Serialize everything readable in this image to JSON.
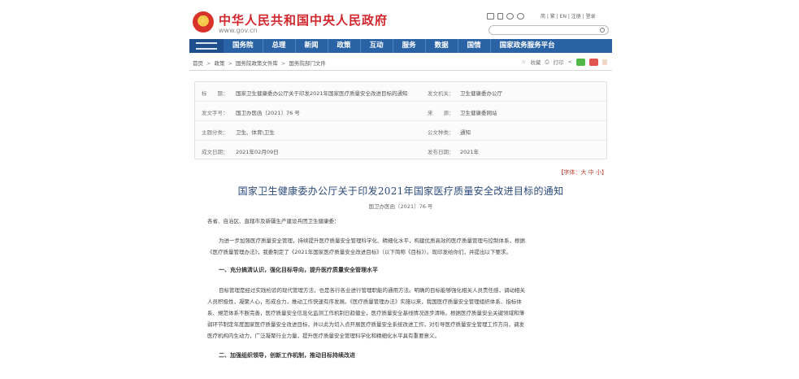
{
  "header": {
    "site_title": "中华人民共和国中央人民政府",
    "site_url": "www.gov.cn",
    "util_links": "简 | 繁 | EN | 注册 | 登录"
  },
  "nav": {
    "items": [
      "国务院",
      "总理",
      "新闻",
      "政策",
      "互动",
      "服务",
      "数据",
      "国情",
      "国家政务服务平台"
    ]
  },
  "breadcrumb": {
    "items": [
      "首页",
      "政策",
      "国务院政策文件库",
      "国务院部门文件"
    ]
  },
  "tools": {
    "favorite": "收藏",
    "print": "打印"
  },
  "doc_info": {
    "title_label": "标　　题：",
    "title_value": "国家卫生健康委办公厅关于印发2021年国家医疗质量安全改进目标的通知",
    "issuer_label": "发文机关：",
    "issuer_value": "卫生健康委办公厅",
    "number_label": "发文字号：",
    "number_value": "国卫办医函〔2021〕76 号",
    "source_label": "来　　源：",
    "source_value": "卫生健康委网站",
    "topic_label": "主题分类：",
    "topic_value": "卫生、体育\\卫生",
    "type_label": "公文种类：",
    "type_value": "通知",
    "written_label": "成文日期：",
    "written_value": "2021年02月09日",
    "published_label": "发布日期：",
    "published_value": "2021年"
  },
  "font_size_label": "【字体：大 中 小】",
  "article": {
    "title": "国家卫生健康委办公厅关于印发2021年国家医疗质量安全改进目标的通知",
    "doc_number": "国卫办医函〔2021〕76 号",
    "salutation": "各省、自治区、直辖市及新疆生产建设兵团卫生健康委：",
    "p1_line1": "为进一步加强医疗质量安全管理，持续提升医疗质量安全管理科学化、精细化水平，构建优质高效的医疗质量管理与控制体系，根据",
    "p1_line2": "《医疗质量管理办法》，我委制定了《2021年国家医疗质量安全改进目标》（以下简称《目标》）。现印发给你们，并提出以下要求。",
    "section1": "一、充分搞清认识，强化目标导向，提升医疗质量安全管理水平",
    "p2_line1": "目标管理是经过实践检验的现代管理方法，也是各行各业进行管理职能的通用方法。明确的目标能够强化相关人员责任感，调动相关",
    "p2_line2": "人员积极性，凝聚人心，形成合力，推动工作快速有序发展。《医疗质量管理办法》实施以来，我国医疗质量安全管理组织体系、指标体",
    "p2_line3": "系、規范体系不断完善，医疗质量安全信息化监测工作机制日趋健全，医疗质量安全基线情况逐步清晰。根据医疗质量安全关键领域和薄",
    "p2_line4": "弱环节制定年度国家医疗质量安全改进目标，并以此为切入点开展医疗质量安全系统改进工作，对引导医疗质量安全管理工作方向，调发",
    "p2_line5": "医疗机构内生动力，广泛凝聚行业力量，提升医疗质量安全管理科学化和精细化水平具有重要意义。",
    "section2": "二、加强组织领导，创新工作机制，推动目标持续改进"
  }
}
